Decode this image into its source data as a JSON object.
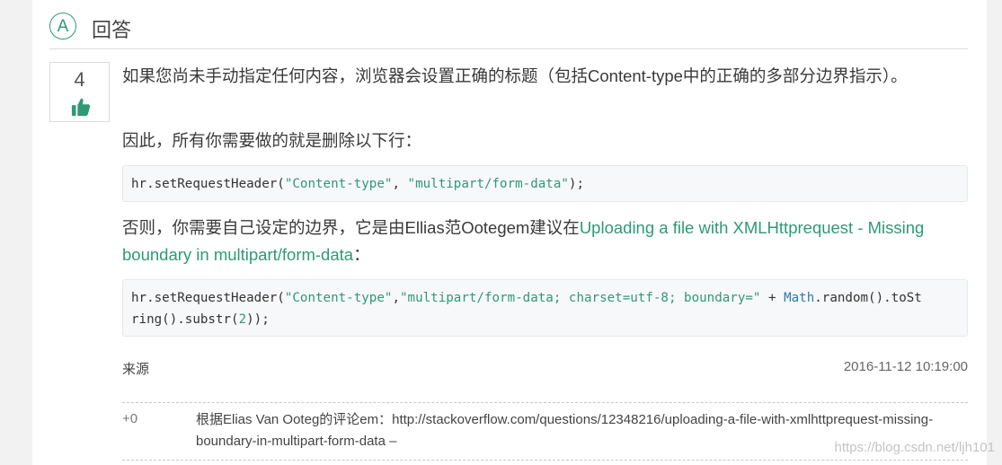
{
  "header": {
    "badge": "A",
    "title": "回答"
  },
  "vote": {
    "count": "4"
  },
  "answer": {
    "paragraph1": "如果您尚未手动指定任何内容，浏览器会设置正确的标题（包括Content-type中的正确的多部分边界指示）。",
    "paragraph2": "因此，所有你需要做的就是删除以下行：",
    "paragraph3_prefix": "否则，你需要自己设定的边界，它是由Ellias范Ootegem建议在",
    "paragraph3_link": "Uploading a file with XMLHttprequest - Missing boundary in multipart/form-data",
    "paragraph3_suffix": "："
  },
  "code1": {
    "a": "hr.setRequestHeader(",
    "b": "\"Content-type\"",
    "c": ", ",
    "d": "\"multipart/form-data\"",
    "e": ");"
  },
  "code2": {
    "a": "hr.setRequestHeader(",
    "b": "\"Content-type\"",
    "c": ",",
    "d": "\"multipart/form-data; charset=utf-8; boundary=\"",
    "e": " + ",
    "f": "Math",
    "g": ".random().toSt",
    "h": "ring().substr(",
    "i": "2",
    "j": "));"
  },
  "meta": {
    "source_label": "来源",
    "timestamp": "2016-11-12 10:19:00"
  },
  "comment": {
    "score": "+0",
    "text": "根据Elias Van Ooteg的评论em：http://stackoverflow.com/questions/12348216/uploading-a-file-with-xmlhttprequest-missing-boundary-in-multipart-form-data –"
  },
  "watermark": "https://blog.csdn.net/ljh101",
  "colors": {
    "accent": "#2e9a74",
    "code_bg": "#f7f8f9"
  },
  "icons": {
    "vote": "thumbs-up-icon"
  }
}
